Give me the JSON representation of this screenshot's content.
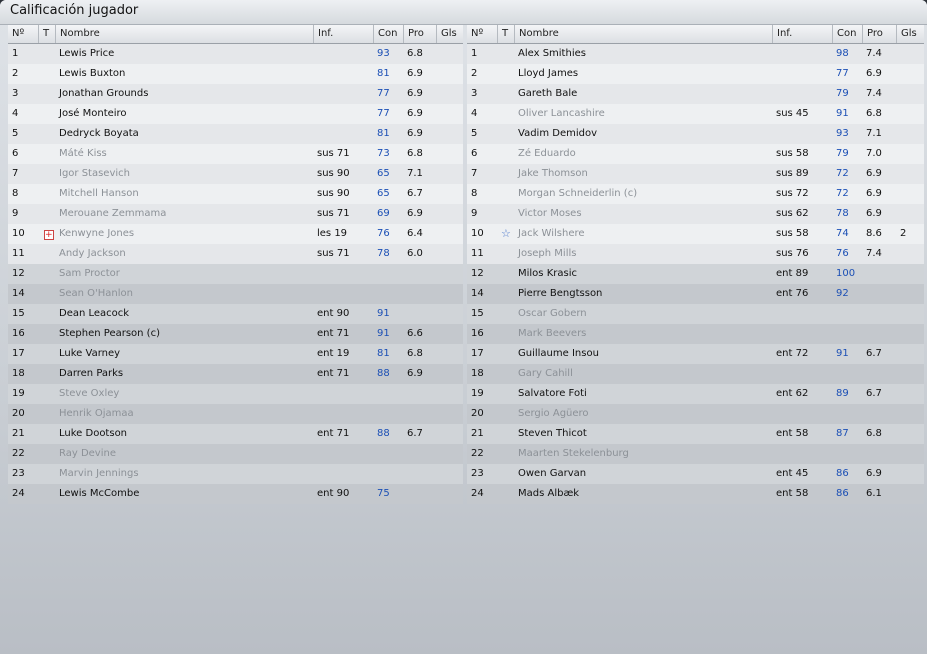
{
  "window": {
    "title": "Calificación jugador"
  },
  "columns": {
    "num": "Nº",
    "t": "T",
    "name": "Nombre",
    "inf": "Inf.",
    "con": "Con",
    "pro": "Pro",
    "gls": "Gls"
  },
  "left_rows": [
    {
      "num": "1",
      "name": "Lewis Price",
      "inf": "",
      "con": "93",
      "pro": "6.8",
      "gls": "",
      "dim": false,
      "icon": ""
    },
    {
      "num": "2",
      "name": "Lewis Buxton",
      "inf": "",
      "con": "81",
      "pro": "6.9",
      "gls": "",
      "dim": false,
      "icon": ""
    },
    {
      "num": "3",
      "name": "Jonathan Grounds",
      "inf": "",
      "con": "77",
      "pro": "6.9",
      "gls": "",
      "dim": false,
      "icon": ""
    },
    {
      "num": "4",
      "name": "José Monteiro",
      "inf": "",
      "con": "77",
      "pro": "6.9",
      "gls": "",
      "dim": false,
      "icon": ""
    },
    {
      "num": "5",
      "name": "Dedryck Boyata",
      "inf": "",
      "con": "81",
      "pro": "6.9",
      "gls": "",
      "dim": false,
      "icon": ""
    },
    {
      "num": "6",
      "name": "Máté Kiss",
      "inf": "sus 71",
      "con": "73",
      "pro": "6.8",
      "gls": "",
      "dim": true,
      "icon": ""
    },
    {
      "num": "7",
      "name": "Igor Stasevich",
      "inf": "sus 90",
      "con": "65",
      "pro": "7.1",
      "gls": "",
      "dim": true,
      "icon": ""
    },
    {
      "num": "8",
      "name": "Mitchell Hanson",
      "inf": "sus 90",
      "con": "65",
      "pro": "6.7",
      "gls": "",
      "dim": true,
      "icon": ""
    },
    {
      "num": "9",
      "name": "Merouane Zemmama",
      "inf": "sus 71",
      "con": "69",
      "pro": "6.9",
      "gls": "",
      "dim": true,
      "icon": ""
    },
    {
      "num": "10",
      "name": "Kenwyne Jones",
      "inf": "les 19",
      "con": "76",
      "pro": "6.4",
      "gls": "",
      "dim": true,
      "icon": "injury"
    },
    {
      "num": "11",
      "name": "Andy Jackson",
      "inf": "sus 71",
      "con": "78",
      "pro": "6.0",
      "gls": "",
      "dim": true,
      "icon": ""
    },
    {
      "num": "12",
      "name": "Sam Proctor",
      "inf": "",
      "con": "",
      "pro": "",
      "gls": "",
      "dim": true,
      "icon": ""
    },
    {
      "num": "14",
      "name": "Sean O'Hanlon",
      "inf": "",
      "con": "",
      "pro": "",
      "gls": "",
      "dim": true,
      "icon": ""
    },
    {
      "num": "15",
      "name": "Dean Leacock",
      "inf": "ent 90",
      "con": "91",
      "pro": "",
      "gls": "",
      "dim": false,
      "icon": ""
    },
    {
      "num": "16",
      "name": "Stephen Pearson (c)",
      "inf": "ent 71",
      "con": "91",
      "pro": "6.6",
      "gls": "",
      "dim": false,
      "icon": ""
    },
    {
      "num": "17",
      "name": "Luke Varney",
      "inf": "ent 19",
      "con": "81",
      "pro": "6.8",
      "gls": "",
      "dim": false,
      "icon": ""
    },
    {
      "num": "18",
      "name": "Darren Parks",
      "inf": "ent 71",
      "con": "88",
      "pro": "6.9",
      "gls": "",
      "dim": false,
      "icon": ""
    },
    {
      "num": "19",
      "name": "Steve Oxley",
      "inf": "",
      "con": "",
      "pro": "",
      "gls": "",
      "dim": true,
      "icon": ""
    },
    {
      "num": "20",
      "name": "Henrik Ojamaa",
      "inf": "",
      "con": "",
      "pro": "",
      "gls": "",
      "dim": true,
      "icon": ""
    },
    {
      "num": "21",
      "name": "Luke Dootson",
      "inf": "ent 71",
      "con": "88",
      "pro": "6.7",
      "gls": "",
      "dim": false,
      "icon": ""
    },
    {
      "num": "22",
      "name": "Ray Devine",
      "inf": "",
      "con": "",
      "pro": "",
      "gls": "",
      "dim": true,
      "icon": ""
    },
    {
      "num": "23",
      "name": "Marvin Jennings",
      "inf": "",
      "con": "",
      "pro": "",
      "gls": "",
      "dim": true,
      "icon": ""
    },
    {
      "num": "24",
      "name": "Lewis McCombe",
      "inf": "ent 90",
      "con": "75",
      "pro": "",
      "gls": "",
      "dim": false,
      "icon": ""
    }
  ],
  "right_rows": [
    {
      "num": "1",
      "name": "Alex Smithies",
      "inf": "",
      "con": "98",
      "pro": "7.4",
      "gls": "",
      "dim": false,
      "icon": ""
    },
    {
      "num": "2",
      "name": "Lloyd James",
      "inf": "",
      "con": "77",
      "pro": "6.9",
      "gls": "",
      "dim": false,
      "icon": ""
    },
    {
      "num": "3",
      "name": "Gareth Bale",
      "inf": "",
      "con": "79",
      "pro": "7.4",
      "gls": "",
      "dim": false,
      "icon": ""
    },
    {
      "num": "4",
      "name": "Oliver Lancashire",
      "inf": "sus 45",
      "con": "91",
      "pro": "6.8",
      "gls": "",
      "dim": true,
      "icon": ""
    },
    {
      "num": "5",
      "name": "Vadim Demidov",
      "inf": "",
      "con": "93",
      "pro": "7.1",
      "gls": "",
      "dim": false,
      "icon": ""
    },
    {
      "num": "6",
      "name": "Zé Eduardo",
      "inf": "sus 58",
      "con": "79",
      "pro": "7.0",
      "gls": "",
      "dim": true,
      "icon": ""
    },
    {
      "num": "7",
      "name": "Jake Thomson",
      "inf": "sus 89",
      "con": "72",
      "pro": "6.9",
      "gls": "",
      "dim": true,
      "icon": ""
    },
    {
      "num": "8",
      "name": "Morgan Schneiderlin (c)",
      "inf": "sus 72",
      "con": "72",
      "pro": "6.9",
      "gls": "",
      "dim": true,
      "icon": ""
    },
    {
      "num": "9",
      "name": "Victor Moses",
      "inf": "sus 62",
      "con": "78",
      "pro": "6.9",
      "gls": "",
      "dim": true,
      "icon": ""
    },
    {
      "num": "10",
      "name": "Jack Wilshere",
      "inf": "sus 58",
      "con": "74",
      "pro": "8.6",
      "gls": "2",
      "dim": true,
      "icon": "star"
    },
    {
      "num": "11",
      "name": "Joseph Mills",
      "inf": "sus 76",
      "con": "76",
      "pro": "7.4",
      "gls": "",
      "dim": true,
      "icon": ""
    },
    {
      "num": "12",
      "name": "Milos Krasic",
      "inf": "ent 89",
      "con": "100",
      "pro": "",
      "gls": "",
      "dim": false,
      "icon": ""
    },
    {
      "num": "14",
      "name": "Pierre Bengtsson",
      "inf": "ent 76",
      "con": "92",
      "pro": "",
      "gls": "",
      "dim": false,
      "icon": ""
    },
    {
      "num": "15",
      "name": "Oscar Gobern",
      "inf": "",
      "con": "",
      "pro": "",
      "gls": "",
      "dim": true,
      "icon": ""
    },
    {
      "num": "16",
      "name": "Mark Beevers",
      "inf": "",
      "con": "",
      "pro": "",
      "gls": "",
      "dim": true,
      "icon": ""
    },
    {
      "num": "17",
      "name": "Guillaume Insou",
      "inf": "ent 72",
      "con": "91",
      "pro": "6.7",
      "gls": "",
      "dim": false,
      "icon": ""
    },
    {
      "num": "18",
      "name": "Gary Cahill",
      "inf": "",
      "con": "",
      "pro": "",
      "gls": "",
      "dim": true,
      "icon": ""
    },
    {
      "num": "19",
      "name": "Salvatore Foti",
      "inf": "ent 62",
      "con": "89",
      "pro": "6.7",
      "gls": "",
      "dim": false,
      "icon": ""
    },
    {
      "num": "20",
      "name": "Sergio Agüero",
      "inf": "",
      "con": "",
      "pro": "",
      "gls": "",
      "dim": true,
      "icon": ""
    },
    {
      "num": "21",
      "name": "Steven Thicot",
      "inf": "ent 58",
      "con": "87",
      "pro": "6.8",
      "gls": "",
      "dim": false,
      "icon": ""
    },
    {
      "num": "22",
      "name": "Maarten Stekelenburg",
      "inf": "",
      "con": "",
      "pro": "",
      "gls": "",
      "dim": true,
      "icon": ""
    },
    {
      "num": "23",
      "name": "Owen Garvan",
      "inf": "ent 45",
      "con": "86",
      "pro": "6.9",
      "gls": "",
      "dim": false,
      "icon": ""
    },
    {
      "num": "24",
      "name": "Mads Albæk",
      "inf": "ent 58",
      "con": "86",
      "pro": "6.1",
      "gls": "",
      "dim": false,
      "icon": ""
    }
  ]
}
